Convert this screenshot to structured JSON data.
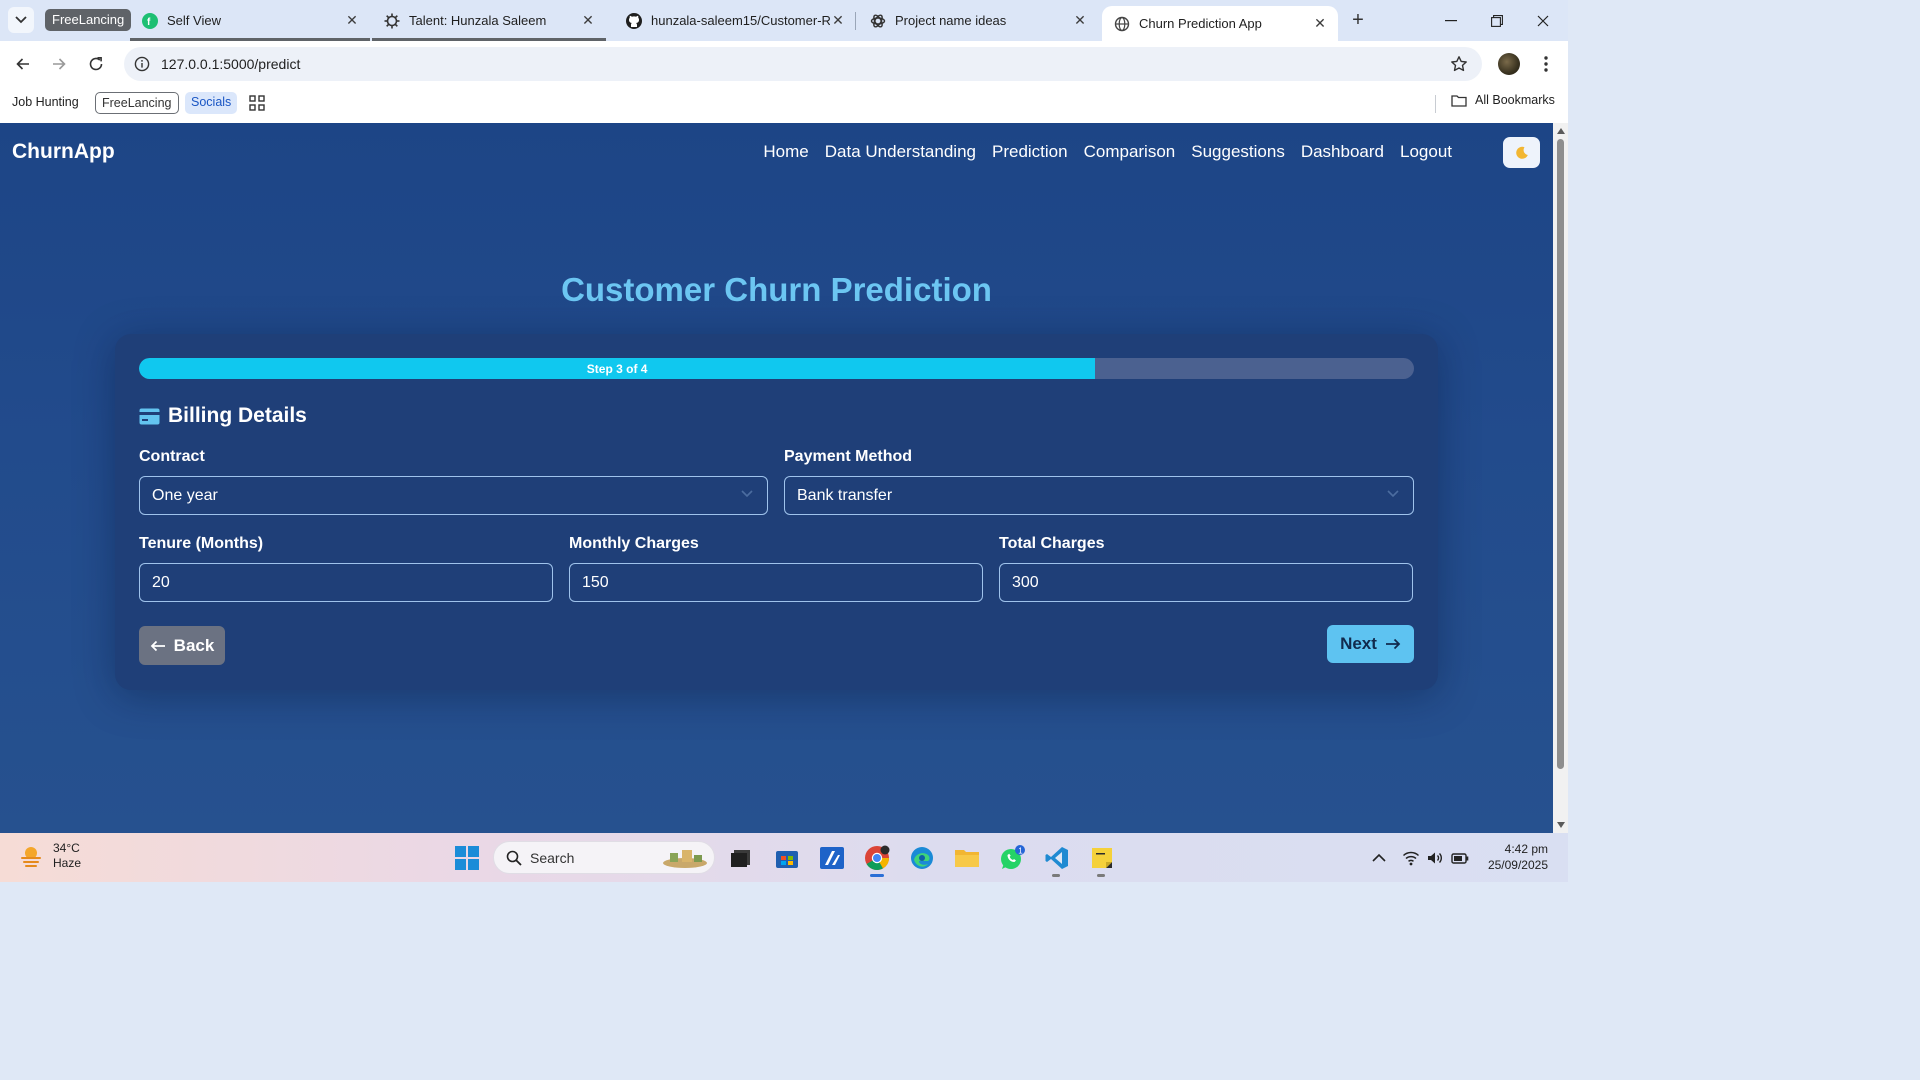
{
  "browser": {
    "tab_group_label": "FreeLancing",
    "tabs": [
      {
        "title": "Self View",
        "icon": "fiverr-icon"
      },
      {
        "title": "Talent: Hunzala Saleem",
        "icon": "upwork-gear-icon"
      },
      {
        "title": "hunzala-saleem15/Customer-R",
        "icon": "github-icon"
      },
      {
        "title": "Project name ideas",
        "icon": "chatgpt-icon"
      },
      {
        "title": "Churn Prediction App",
        "icon": "globe-icon"
      }
    ],
    "url": "127.0.0.1:5000/predict",
    "bookmarks": [
      "Job Hunting",
      "FreeLancing",
      "Socials"
    ],
    "all_bookmarks_label": "All Bookmarks"
  },
  "app": {
    "brand": "ChurnApp",
    "nav": [
      "Home",
      "Data Understanding",
      "Prediction",
      "Comparison",
      "Suggestions",
      "Dashboard",
      "Logout"
    ],
    "theme_toggle_icon": "moon-icon",
    "page_title": "Customer Churn Prediction",
    "progress": {
      "label": "Step 3 of 4",
      "fraction": 0.75
    },
    "section_title": "Billing Details",
    "fields": {
      "contract": {
        "label": "Contract",
        "value": "One year"
      },
      "payment_method": {
        "label": "Payment Method",
        "value": "Bank transfer"
      },
      "tenure": {
        "label": "Tenure (Months)",
        "value": "20"
      },
      "monthly_charges": {
        "label": "Monthly Charges",
        "value": "150"
      },
      "total_charges": {
        "label": "Total Charges",
        "value": "300"
      }
    },
    "buttons": {
      "back": "Back",
      "next": "Next"
    },
    "colors": {
      "accent": "#10c8ef",
      "title": "#6cc6f2",
      "background": "#224b8c",
      "next_button": "#5ec3f1",
      "back_button": "#6b7282"
    }
  },
  "taskbar": {
    "weather_temp": "34°C",
    "weather_desc": "Haze",
    "search_placeholder": "Search",
    "whatsapp_badge": "1",
    "time": "4:42 pm",
    "date": "25/09/2025"
  }
}
